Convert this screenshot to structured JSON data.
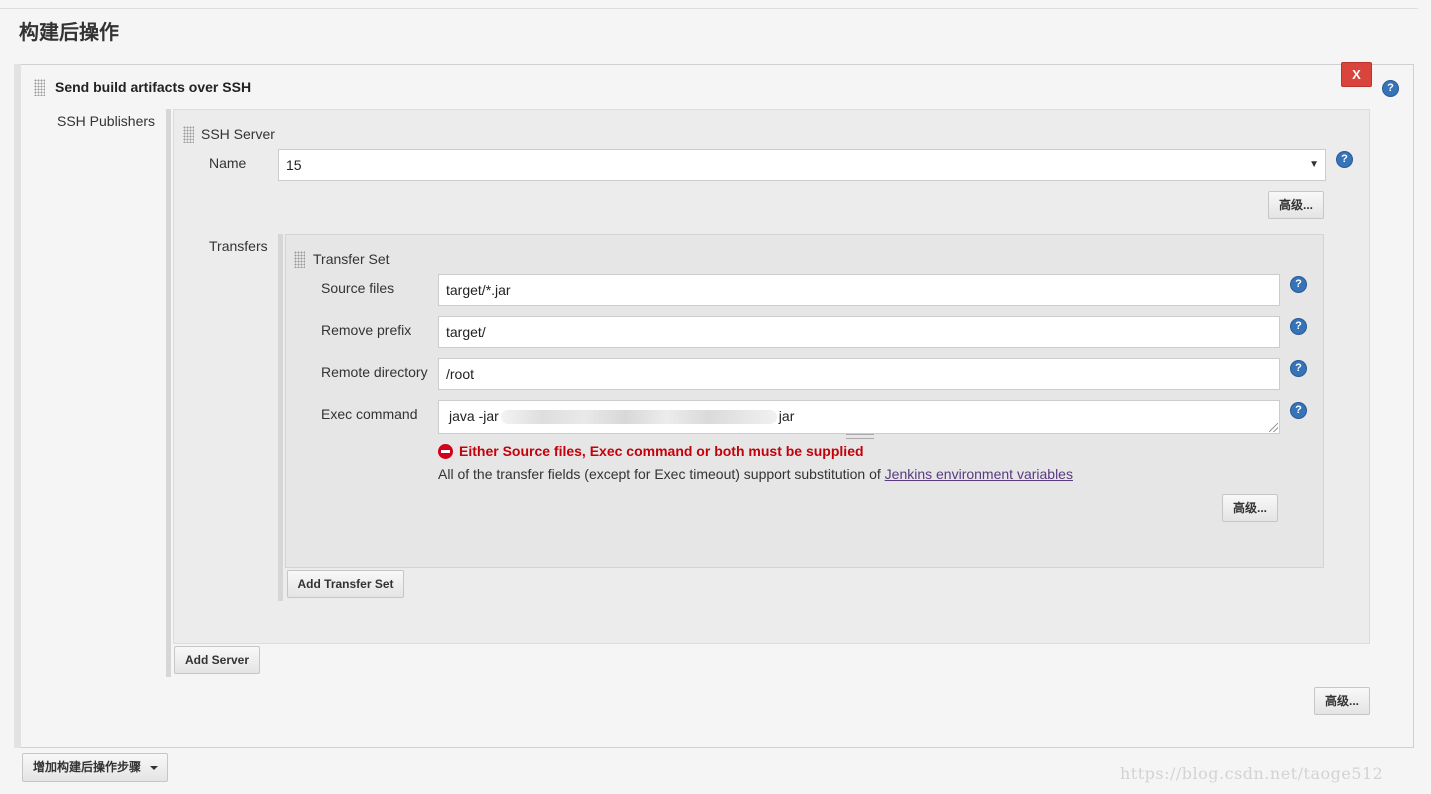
{
  "section": {
    "title": "构建后操作"
  },
  "step": {
    "title": "Send build artifacts over SSH",
    "delete_label": "X",
    "advanced_label": "高级..."
  },
  "publishers": {
    "label": "SSH Publishers",
    "server": {
      "title": "SSH Server",
      "name_label": "Name",
      "name_value": "15",
      "advanced_label": "高级...",
      "transfers_label": "Transfers",
      "add_server_label": "Add Server"
    },
    "transfer_set": {
      "title": "Transfer Set",
      "source_files_label": "Source files",
      "source_files_value": "target/*.jar",
      "remove_prefix_label": "Remove prefix",
      "remove_prefix_value": "target/",
      "remote_directory_label": "Remote directory",
      "remote_directory_value": "/root",
      "exec_command_label": "Exec command",
      "exec_command_prefix": "java -jar",
      "exec_command_suffix": "jar",
      "error_message": "Either Source files, Exec command or both must be supplied",
      "info_text": "All of the transfer fields (except for Exec timeout) support substitution of ",
      "info_link": "Jenkins environment variables",
      "advanced_label": "高级...",
      "add_transfer_set_label": "Add Transfer Set"
    }
  },
  "footer": {
    "add_step_label": "增加构建后操作步骤",
    "watermark": "https://blog.csdn.net/taoge512"
  },
  "colors": {
    "delete_button": "#d9453c",
    "help_icon": "#3673b8",
    "error_text": "#c4000a",
    "link": "#5a3a80"
  }
}
